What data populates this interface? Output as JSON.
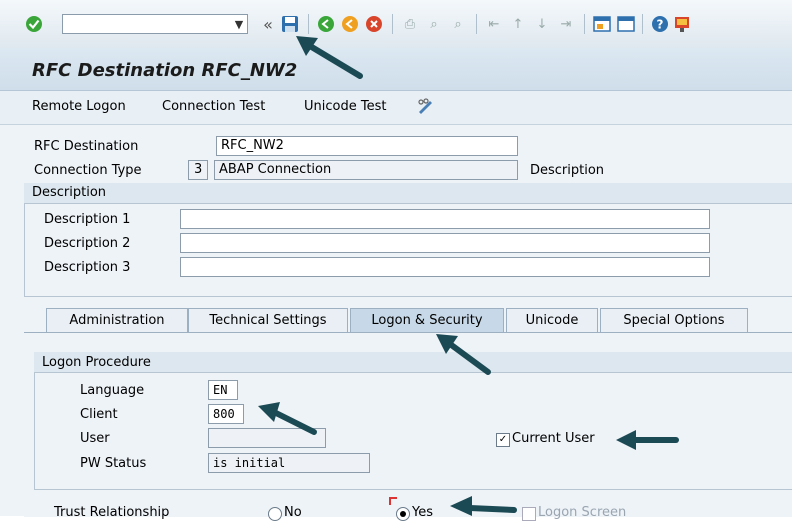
{
  "toolbar": {
    "command_value": "",
    "icons": [
      "check-icon",
      "back-icon",
      "save-icon",
      "back-green-icon",
      "exit-icon",
      "cancel-icon",
      "print-icon",
      "find-icon",
      "find-next-icon",
      "first-page-icon",
      "prev-page-icon",
      "next-page-icon",
      "last-page-icon",
      "new-session-icon",
      "shortcut-icon",
      "help-icon",
      "layout-icon"
    ]
  },
  "title": "RFC Destination RFC_NW2",
  "app_toolbar": {
    "remote_logon": "Remote Logon",
    "connection_test": "Connection Test",
    "unicode_test": "Unicode Test"
  },
  "form": {
    "rfc_destination_label": "RFC Destination",
    "rfc_destination_value": "RFC_NW2",
    "connection_type_label": "Connection Type",
    "connection_type_code": "3",
    "connection_type_value": "ABAP Connection",
    "description_label": "Description"
  },
  "description_group": {
    "header": "Description",
    "desc1_label": "Description 1",
    "desc2_label": "Description 2",
    "desc3_label": "Description 3",
    "desc1_value": "",
    "desc2_value": "",
    "desc3_value": ""
  },
  "tabs": [
    {
      "label": "Administration"
    },
    {
      "label": "Technical Settings"
    },
    {
      "label": "Logon & Security"
    },
    {
      "label": "Unicode"
    },
    {
      "label": "Special Options"
    }
  ],
  "logon": {
    "header": "Logon Procedure",
    "language_label": "Language",
    "language_value": "EN",
    "client_label": "Client",
    "client_value": "800",
    "user_label": "User",
    "user_value": "",
    "pw_status_label": "PW Status",
    "pw_status_value": "is initial",
    "current_user_label": "Current User",
    "current_user_checked": true
  },
  "trust": {
    "label": "Trust Relationship",
    "no_label": "No",
    "yes_label": "Yes",
    "logon_screen_label": "Logon Screen"
  },
  "colors": {
    "arrow": "#1c4a54",
    "accent_green": "#3aa63a",
    "save_blue": "#2e6fae"
  }
}
